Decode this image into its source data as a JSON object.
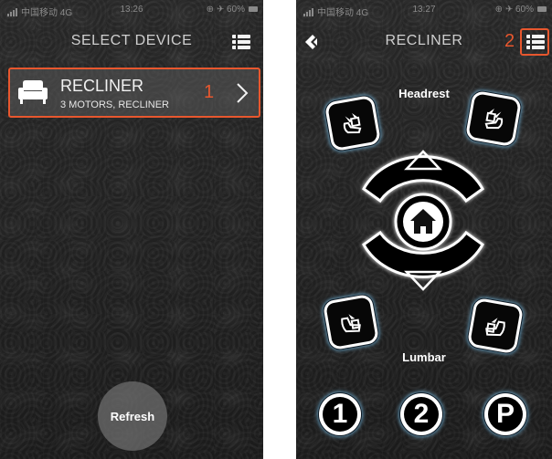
{
  "status_bar": {
    "left": {
      "carrier": "中国移动 4G",
      "time": "13:26",
      "battery": "⊕ ✈ 60%"
    },
    "right": {
      "carrier": "中国移动 4G",
      "time": "13:27",
      "battery": "⊕ ✈ 60%"
    }
  },
  "select_screen": {
    "title": "SELECT DEVICE",
    "device": {
      "name": "RECLINER",
      "subtitle": "3 MOTORS, RECLINER",
      "annotation": "1"
    },
    "refresh_label": "Refresh"
  },
  "control_screen": {
    "title": "RECLINER",
    "menu_annotation": "2",
    "headrest_label": "Headrest",
    "lumbar_label": "Lumbar",
    "memory_buttons": [
      "1",
      "2",
      "P"
    ]
  },
  "colors": {
    "accent_annotation": "#e8572e",
    "glow": "#78bee6",
    "background": "#262626"
  },
  "icons": [
    "menu-list-icon",
    "sofa-icon",
    "chevron-right-icon",
    "back-icon",
    "up-triangle-icon",
    "down-triangle-icon",
    "home-icon",
    "recliner-head-icon"
  ]
}
